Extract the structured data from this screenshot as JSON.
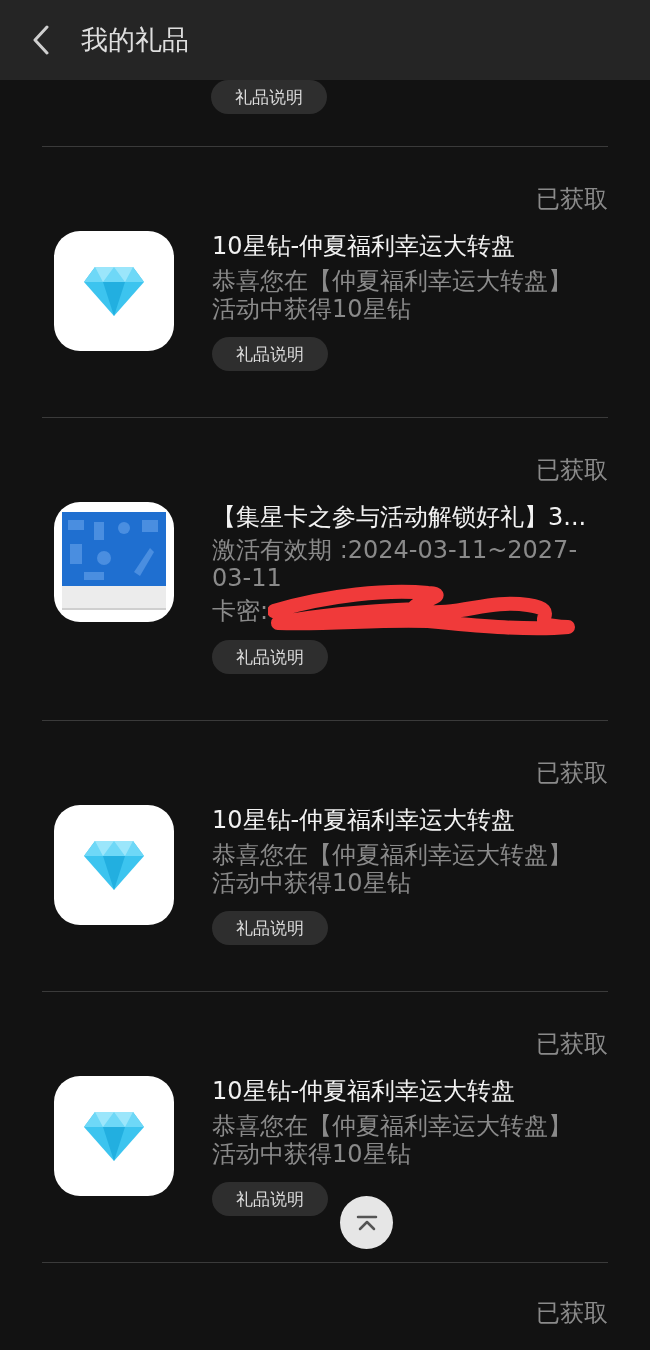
{
  "header": {
    "title": "我的礼品"
  },
  "gifts": [
    {
      "kind": "partial",
      "button": "礼品说明"
    },
    {
      "kind": "diamond",
      "status": "已获取",
      "title": "10星钻-仲夏福利幸运大转盘",
      "description": "恭喜您在【仲夏福利幸运大转盘】活动中获得10星钻",
      "button": "礼品说明"
    },
    {
      "kind": "card",
      "status": "已获取",
      "title": "【集星卡之参与活动解锁好礼】3...",
      "validity": "激活有效期 :2024-03-11~2027-03-11",
      "code_label": "卡密:",
      "button": "礼品说明"
    },
    {
      "kind": "diamond",
      "status": "已获取",
      "title": "10星钻-仲夏福利幸运大转盘",
      "description": "恭喜您在【仲夏福利幸运大转盘】活动中获得10星钻",
      "button": "礼品说明"
    },
    {
      "kind": "diamond",
      "status": "已获取",
      "title": "10星钻-仲夏福利幸运大转盘",
      "description": "恭喜您在【仲夏福利幸运大转盘】活动中获得10星钻",
      "button": "礼品说明"
    },
    {
      "kind": "status_only",
      "status": "已获取"
    }
  ]
}
